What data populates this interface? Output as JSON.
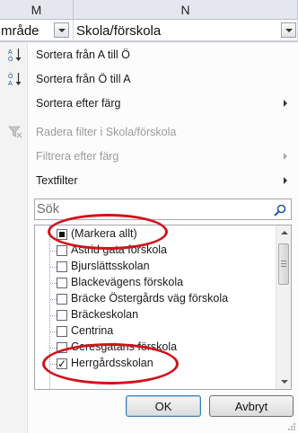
{
  "sheet": {
    "columns": [
      {
        "letter": "M"
      },
      {
        "letter": "N"
      }
    ],
    "cells": {
      "m": "mråde",
      "n": "Skola/förskola"
    }
  },
  "menu": {
    "sort_az": "Sortera från A till Ö",
    "sort_za": "Sortera från Ö till A",
    "sort_color": "Sortera efter färg",
    "clear_filter": "Radera filter i Skola/förskola",
    "filter_color": "Filtrera efter färg",
    "text_filter": "Textfilter"
  },
  "search": {
    "placeholder": "Sök"
  },
  "list": {
    "items": [
      {
        "label": "(Markera allt)",
        "state": "partial"
      },
      {
        "label": "Astrid gata förskola",
        "state": "unchecked"
      },
      {
        "label": "Bjurslättsskolan",
        "state": "unchecked"
      },
      {
        "label": "Blackevägens förskola",
        "state": "unchecked"
      },
      {
        "label": "Bräcke Östergårds väg förskola",
        "state": "unchecked"
      },
      {
        "label": "Bräckeskolan",
        "state": "unchecked"
      },
      {
        "label": "Centrina",
        "state": "unchecked"
      },
      {
        "label": "Ceresgatans förskola",
        "state": "unchecked"
      },
      {
        "label": "Herrgårdsskolan",
        "state": "checked"
      }
    ]
  },
  "buttons": {
    "ok": "OK",
    "cancel": "Avbryt"
  },
  "colors": {
    "annotation": "#d0121b",
    "ok_border": "#3c7fb1"
  },
  "icons": {
    "sort_az": "sort-ascending-icon",
    "sort_za": "sort-descending-icon",
    "clear_filter": "clear-filter-icon",
    "search": "search-icon"
  }
}
